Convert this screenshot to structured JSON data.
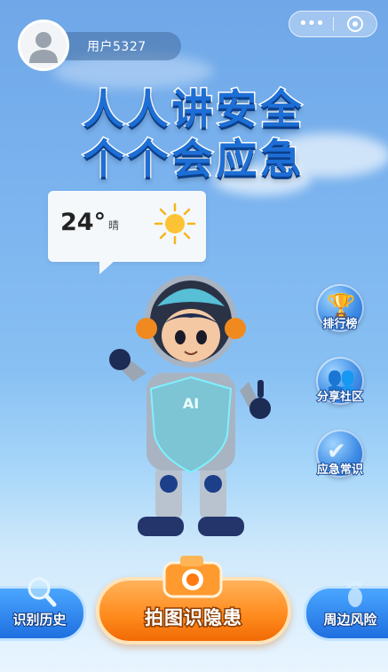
{
  "user": {
    "name": "用户5327"
  },
  "title": {
    "line1": "人人讲安全",
    "line2": "个个会应急"
  },
  "weather": {
    "temperature": "24°",
    "condition": "晴",
    "icon": "sun-icon"
  },
  "robot": {
    "badge": "AI"
  },
  "side_menu": [
    {
      "label": "排行榜",
      "icon": "trophy-icon"
    },
    {
      "label": "分享社区",
      "icon": "community-icon"
    },
    {
      "label": "应急常识",
      "icon": "shield-check-icon"
    }
  ],
  "bottom_bar": {
    "left_label": "识别历史",
    "main_label": "拍图识隐患",
    "right_label": "周边风险"
  },
  "colors": {
    "accent": "#1d6fd6",
    "main_button": "#ff8a1c"
  }
}
